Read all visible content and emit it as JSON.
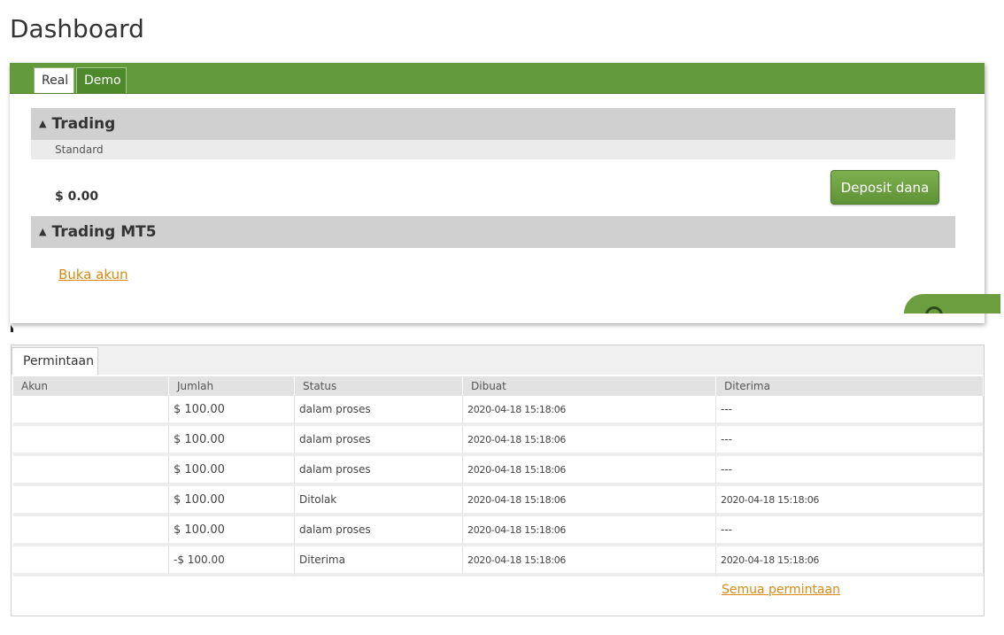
{
  "page": {
    "title": "Dashboard"
  },
  "account_tabs": [
    {
      "label": "Real",
      "selected": true
    },
    {
      "label": "Demo",
      "selected": false
    }
  ],
  "trading": {
    "header": "Trading",
    "type": "Standard",
    "balance": "$ 0.00",
    "deposit_label": "Deposit dana"
  },
  "trading_mt5": {
    "header": "Trading MT5",
    "open_account_label": "Buka akun"
  },
  "requests": {
    "tab_label": "Permintaan",
    "columns": [
      "Akun",
      "Jumlah",
      "Status",
      "Dibuat",
      "Diterima"
    ],
    "rows": [
      {
        "akun": "",
        "jumlah": "$ 100.00",
        "status": "dalam proses",
        "dibuat": "2020-04-18 15:18:06",
        "diterima": "---"
      },
      {
        "akun": "",
        "jumlah": "$ 100.00",
        "status": "dalam proses",
        "dibuat": "2020-04-18 15:18:06",
        "diterima": "---"
      },
      {
        "akun": "",
        "jumlah": "$ 100.00",
        "status": "dalam proses",
        "dibuat": "2020-04-18 15:18:06",
        "diterima": "---"
      },
      {
        "akun": "",
        "jumlah": "$ 100.00",
        "status": "Ditolak",
        "dibuat": "2020-04-18 15:18:06",
        "diterima": "2020-04-18 15:18:06"
      },
      {
        "akun": "",
        "jumlah": "$ 100.00",
        "status": "dalam proses",
        "dibuat": "2020-04-18 15:18:06",
        "diterima": "---"
      },
      {
        "akun": "",
        "jumlah": "-$ 100.00",
        "status": "Diterima",
        "dibuat": "2020-04-18 15:18:06",
        "diterima": "2020-04-18 15:18:06"
      }
    ],
    "all_requests_label": "Semua permintaan"
  },
  "colors": {
    "brand_green": "#639b3c",
    "link_orange": "#d98a12",
    "positive_amount": "#3c8e2a",
    "negative_amount": "#e02020"
  },
  "icons": {
    "collapse": "triangle-up-icon",
    "chat": "chat-icon"
  }
}
